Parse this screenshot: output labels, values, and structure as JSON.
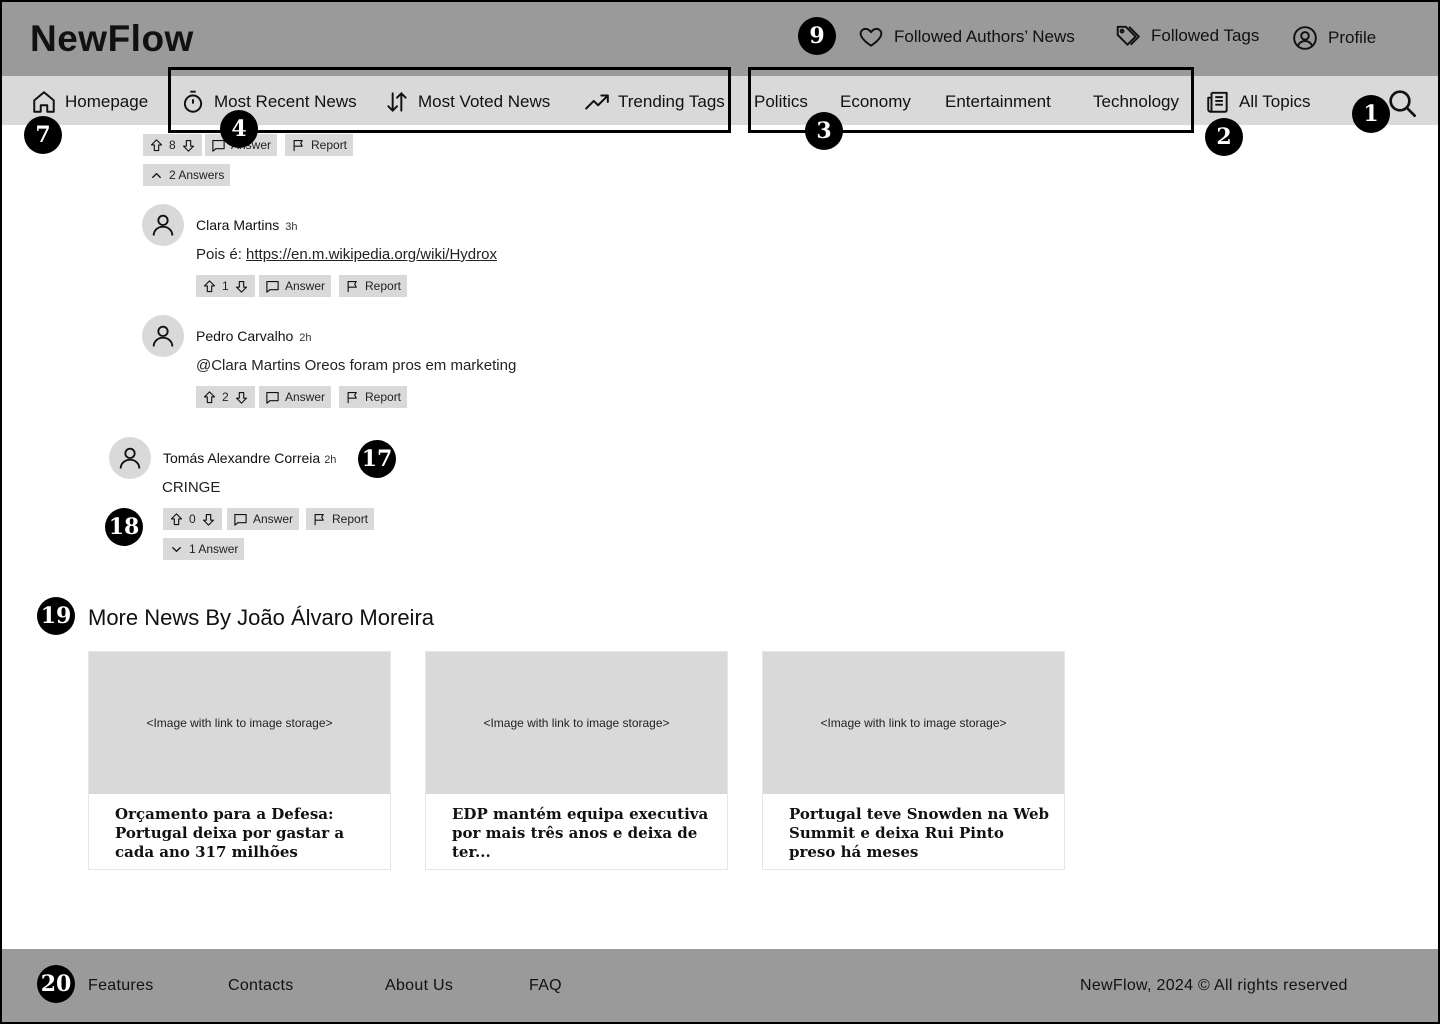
{
  "header": {
    "brand": "NewFlow",
    "followed_authors": "Followed Authors’ News",
    "followed_tags": "Followed Tags",
    "profile": "Profile"
  },
  "nav": {
    "homepage": "Homepage",
    "most_recent": "Most Recent News",
    "most_voted": "Most Voted News",
    "trending": "Trending Tags",
    "topics": [
      "Politics",
      "Economy",
      "Entertainment",
      "Technology"
    ],
    "all_topics": "All Topics"
  },
  "annotations": {
    "search": "1",
    "all_topics": "2",
    "topics": "3",
    "sorting": "4",
    "homepage": "7",
    "followed": "9",
    "comment": "17",
    "comment_actions": "18",
    "more_news": "19",
    "footer": "20"
  },
  "comments": {
    "top_actions": {
      "votes": "8",
      "answer": "Answer",
      "report": "Report",
      "answers_toggle": "2 Answers"
    },
    "replies": [
      {
        "author": "Clara Martins",
        "time": "3h",
        "text_prefix": "Pois é: ",
        "link": "https://en.m.wikipedia.org/wiki/Hydrox",
        "votes": "1",
        "answer": "Answer",
        "report": "Report"
      },
      {
        "author": "Pedro Carvalho",
        "time": "2h",
        "text": "@Clara Martins Oreos foram pros em marketing",
        "votes": "2",
        "answer": "Answer",
        "report": "Report"
      }
    ],
    "main": {
      "author": "Tomás Alexandre Correia",
      "time": "2h",
      "text": "CRINGE",
      "votes": "0",
      "answer": "Answer",
      "report": "Report",
      "answers_toggle": "1 Answer"
    }
  },
  "more_news": {
    "title": "More News By João Álvaro Moreira",
    "cards": [
      {
        "image": "<Image with link to image storage>",
        "title": "Orçamento para a Defesa: Portugal deixa por gastar a cada ano 317 milhões"
      },
      {
        "image": "<Image with link to image storage>",
        "title": "EDP mantém equipa executiva por mais três anos e deixa de ter..."
      },
      {
        "image": "<Image with link to image storage>",
        "title": "Portugal teve Snowden na Web Summit e deixa Rui Pinto preso há meses"
      }
    ]
  },
  "footer": {
    "links": [
      "Features",
      "Contacts",
      "About Us",
      "FAQ"
    ],
    "copyright": "NewFlow, 2024 © All rights reserved"
  }
}
